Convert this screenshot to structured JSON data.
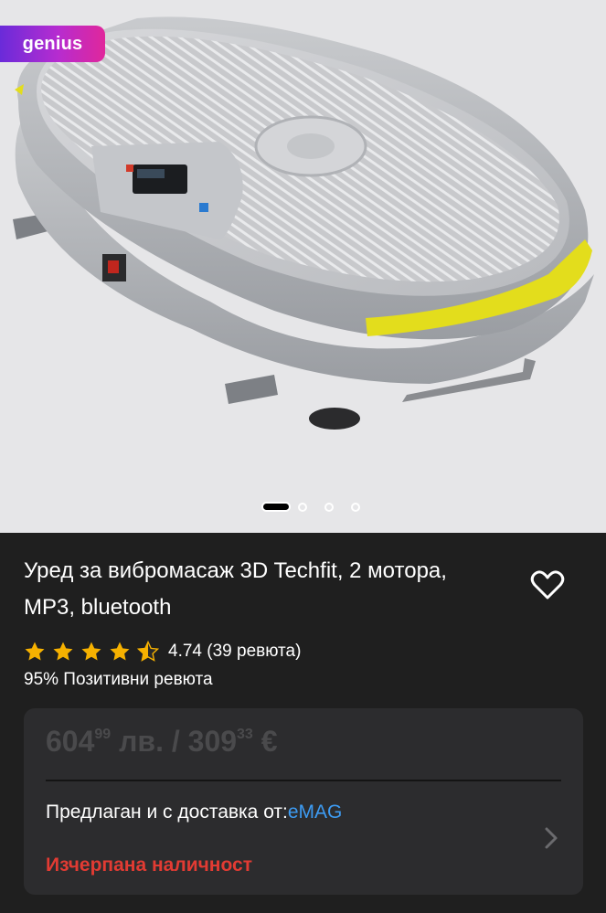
{
  "badge": {
    "label": "genius"
  },
  "gallery": {
    "slide_count": 4,
    "active_slide": 1
  },
  "product": {
    "title": "Уред за вибромасаж 3D Techfit, 2 мотора, MP3, bluetooth",
    "rating_value": 4.74,
    "rating_text": "4.74 (39 ревюта)",
    "positive_reviews": "95% Позитивни ревюта"
  },
  "offer": {
    "price_bgn_int": "604",
    "price_bgn_dec": "99",
    "price_bgn_unit": "лв.",
    "separator": "/",
    "price_eur_int": "309",
    "price_eur_dec": "33",
    "price_eur_unit": "€",
    "seller_prefix": "Предлаган и с доставка от:",
    "seller_name": "eMAG",
    "stock_status": "Изчерпана наличност"
  },
  "colors": {
    "background": "#1f1f1f",
    "card": "#2c2c2e",
    "star": "#f6b100",
    "link": "#3d9bf2",
    "stock": "#e23b33",
    "price_disabled": "#4a4a4c"
  }
}
